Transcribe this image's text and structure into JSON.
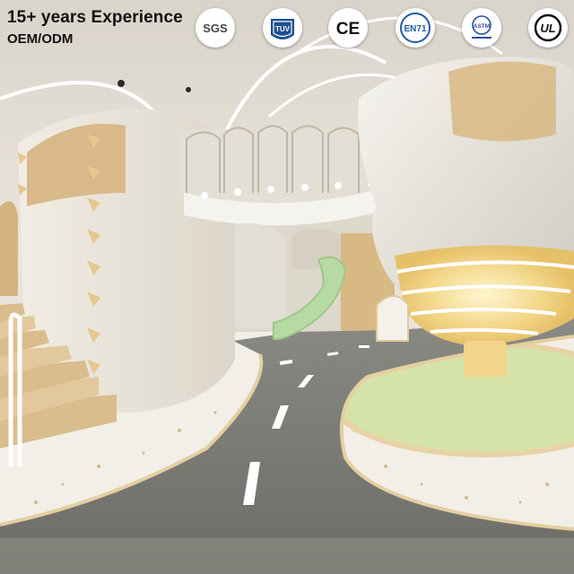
{
  "overlay": {
    "headline": "15+ years Experience",
    "subline": "OEM/ODM"
  },
  "certifications": [
    {
      "icon": "sgs-logo-icon",
      "text": "SGS"
    },
    {
      "icon": "tuv-logo-icon",
      "text": "TUV"
    },
    {
      "icon": "ce-mark-icon",
      "text": "CE"
    },
    {
      "icon": "en71-logo-icon",
      "text": "EN71"
    },
    {
      "icon": "astm-logo-icon",
      "text": "ASTM"
    },
    {
      "icon": "ul-logo-icon",
      "text": "UL"
    }
  ],
  "colors": {
    "road": "#7a7a74",
    "wall": "#f2eee6",
    "wood": "#e2c89c",
    "lime_floor": "#cfe0a0",
    "slide": "#b7d9a4",
    "tuv_blue": "#1d4f91",
    "en71_blue": "#1f5aa6",
    "astm_blue": "#2a4f9e"
  }
}
